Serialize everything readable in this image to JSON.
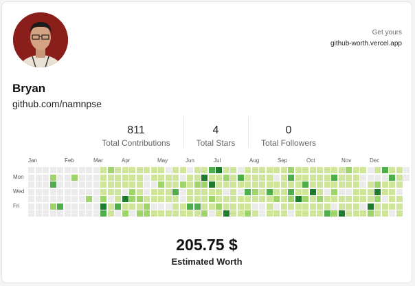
{
  "profile": {
    "name": "Bryan",
    "handle": "github.com/namnpse",
    "avatar_icon": "user-photo"
  },
  "promo": {
    "line1": "Get yours",
    "line2": "github-worth.vercel.app"
  },
  "stats": [
    {
      "value": "811",
      "label": "Total Contributions"
    },
    {
      "value": "4",
      "label": "Total Stars"
    },
    {
      "value": "0",
      "label": "Total Followers"
    }
  ],
  "heatmap": {
    "months": [
      "Jan",
      "Feb",
      "Mar",
      "Apr",
      "May",
      "Jun",
      "Jul",
      "Aug",
      "Sep",
      "Oct",
      "Nov",
      "Dec"
    ],
    "days": [
      "Mon",
      "Wed",
      "Fri"
    ],
    "colors": [
      "#ebebeb",
      "#cfe59a",
      "#9fd46a",
      "#4fae4c",
      "#1e7a2c"
    ],
    "weeks": 53,
    "rows": 7
  },
  "worth": {
    "value": "205.75 $",
    "label": "Estimated Worth"
  }
}
